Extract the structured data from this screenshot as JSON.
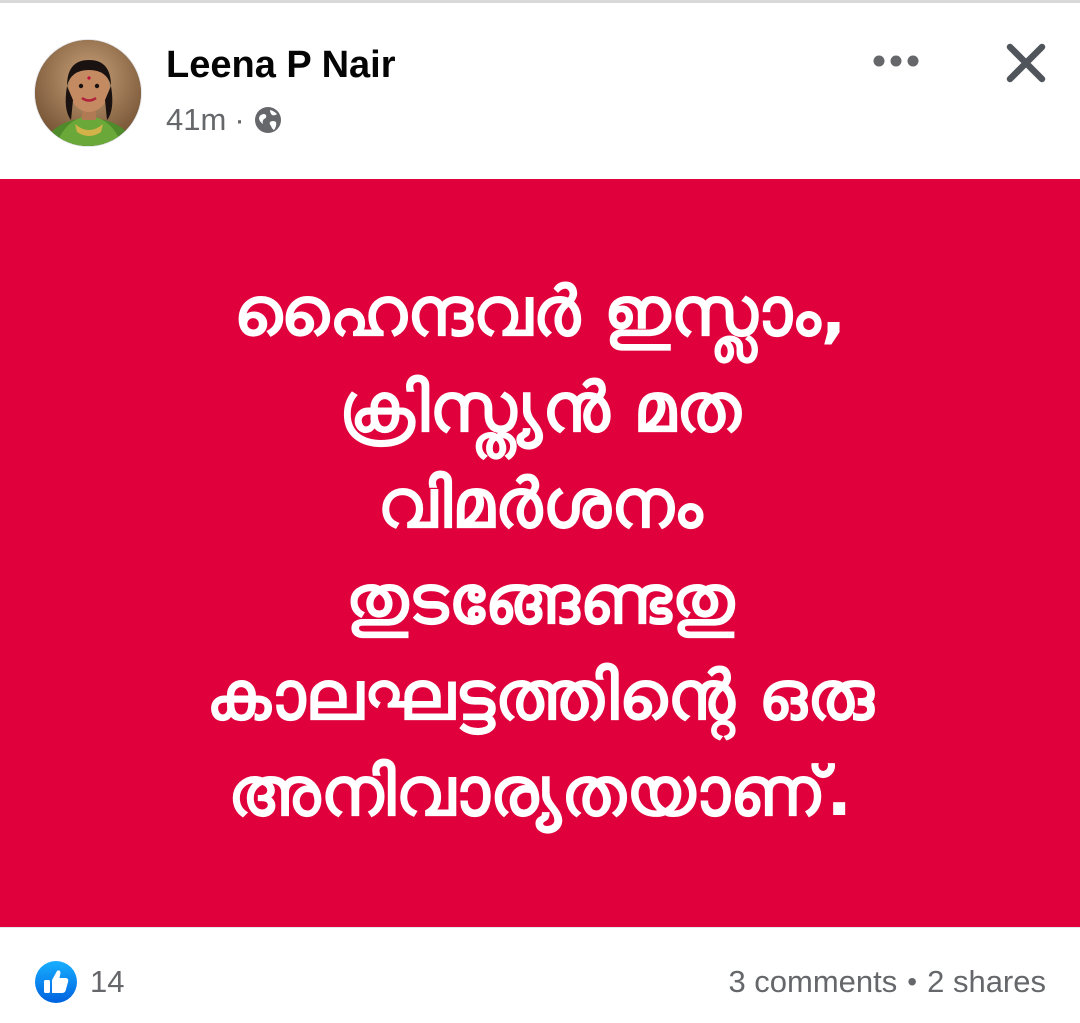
{
  "post": {
    "author_name": "Leena P Nair",
    "timestamp": "41m",
    "separator": "·",
    "audience_icon": "globe-icon",
    "more_icon": "more-horizontal-icon",
    "close_icon": "close-icon"
  },
  "content": {
    "background_color": "#e0003c",
    "text_color": "#ffffff",
    "lines": [
      "ഹൈന്ദവർ ഇസ്ലാം,",
      "ക്രിസ്ത്യൻ മത",
      "വിമർശനം",
      "തുടങ്ങേണ്ടതു",
      "കാലഘട്ടത്തിന്റെ ഒരു",
      "അനിവാര്യതയാണ്."
    ]
  },
  "footer": {
    "like_icon": "like-icon",
    "reaction_count": "14",
    "comments": "3 comments",
    "dot": "•",
    "shares": "2 shares"
  },
  "colors": {
    "accent": "#1877f2",
    "secondary_text": "#65676b",
    "primary_text": "#050505"
  }
}
